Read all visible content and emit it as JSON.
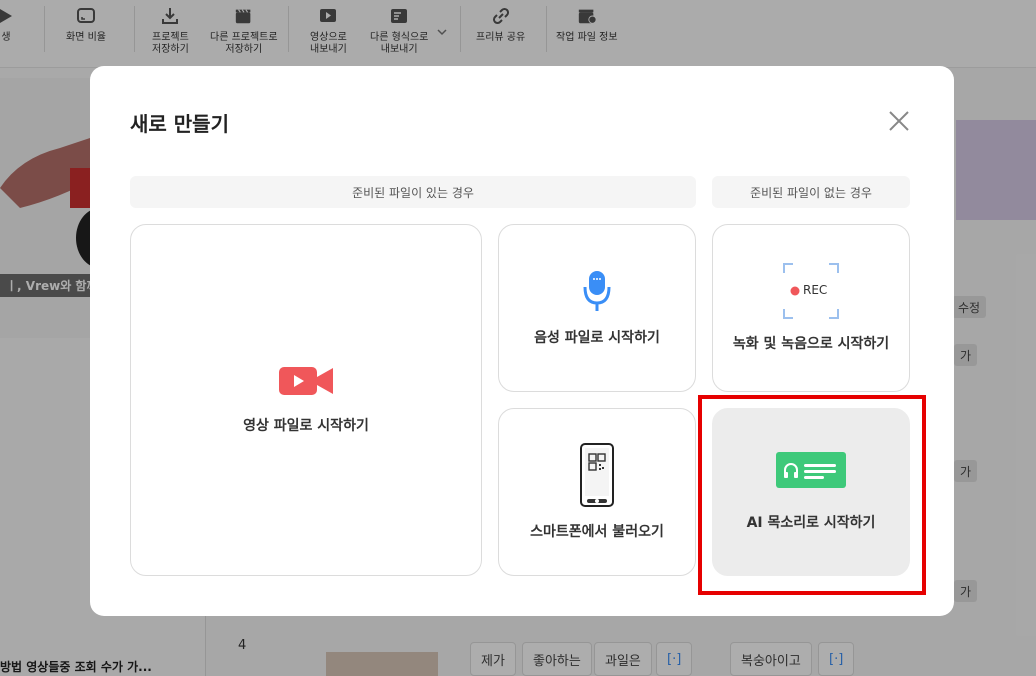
{
  "toolbar": {
    "items": [
      {
        "label": "생",
        "icon": "play-icon"
      },
      {
        "label": "화면 비율",
        "icon": "aspect-ratio-icon"
      },
      {
        "label": "프로젝트\n저장하기",
        "icon": "download-icon"
      },
      {
        "label": "다른 프로젝트로\n저장하기",
        "icon": "clapper-save-icon"
      },
      {
        "label": "영상으로\n내보내기",
        "icon": "video-export-icon"
      },
      {
        "label": "다른 형식으로\n내보내기",
        "icon": "document-export-icon"
      },
      {
        "label": "프리뷰 공유",
        "icon": "link-icon"
      },
      {
        "label": "작업 파일 정보",
        "icon": "clapper-info-icon"
      }
    ]
  },
  "background": {
    "thumb_caption": "ㅣ, Vrew와 함께 ",
    "left_bottom_text": "방법 영상들중 조회 수가 가...",
    "row_number": "4",
    "words": [
      "제가",
      "좋아하는",
      "과일은",
      "[·]",
      "복숭아이고",
      "[·]"
    ],
    "side_chips": [
      "수정",
      "가",
      "가",
      "가"
    ]
  },
  "modal": {
    "title": "새로 만들기",
    "section_with_file": "준비된 파일이 있는 경우",
    "section_without_file": "준비된 파일이 없는 경우",
    "cards": {
      "video": "영상 파일로 시작하기",
      "audio": "음성 파일로 시작하기",
      "record": "녹화 및 녹음으로 시작하기",
      "record_badge": "REC",
      "smartphone": "스마트폰에서 불러오기",
      "ai_voice": "AI 목소리로 시작하기"
    }
  },
  "colors": {
    "video_icon": "#f0575a",
    "mic_icon": "#3a8ef6",
    "ai_icon": "#3ec97a",
    "highlight": "#e60000",
    "rec_dot": "#f0575a"
  }
}
